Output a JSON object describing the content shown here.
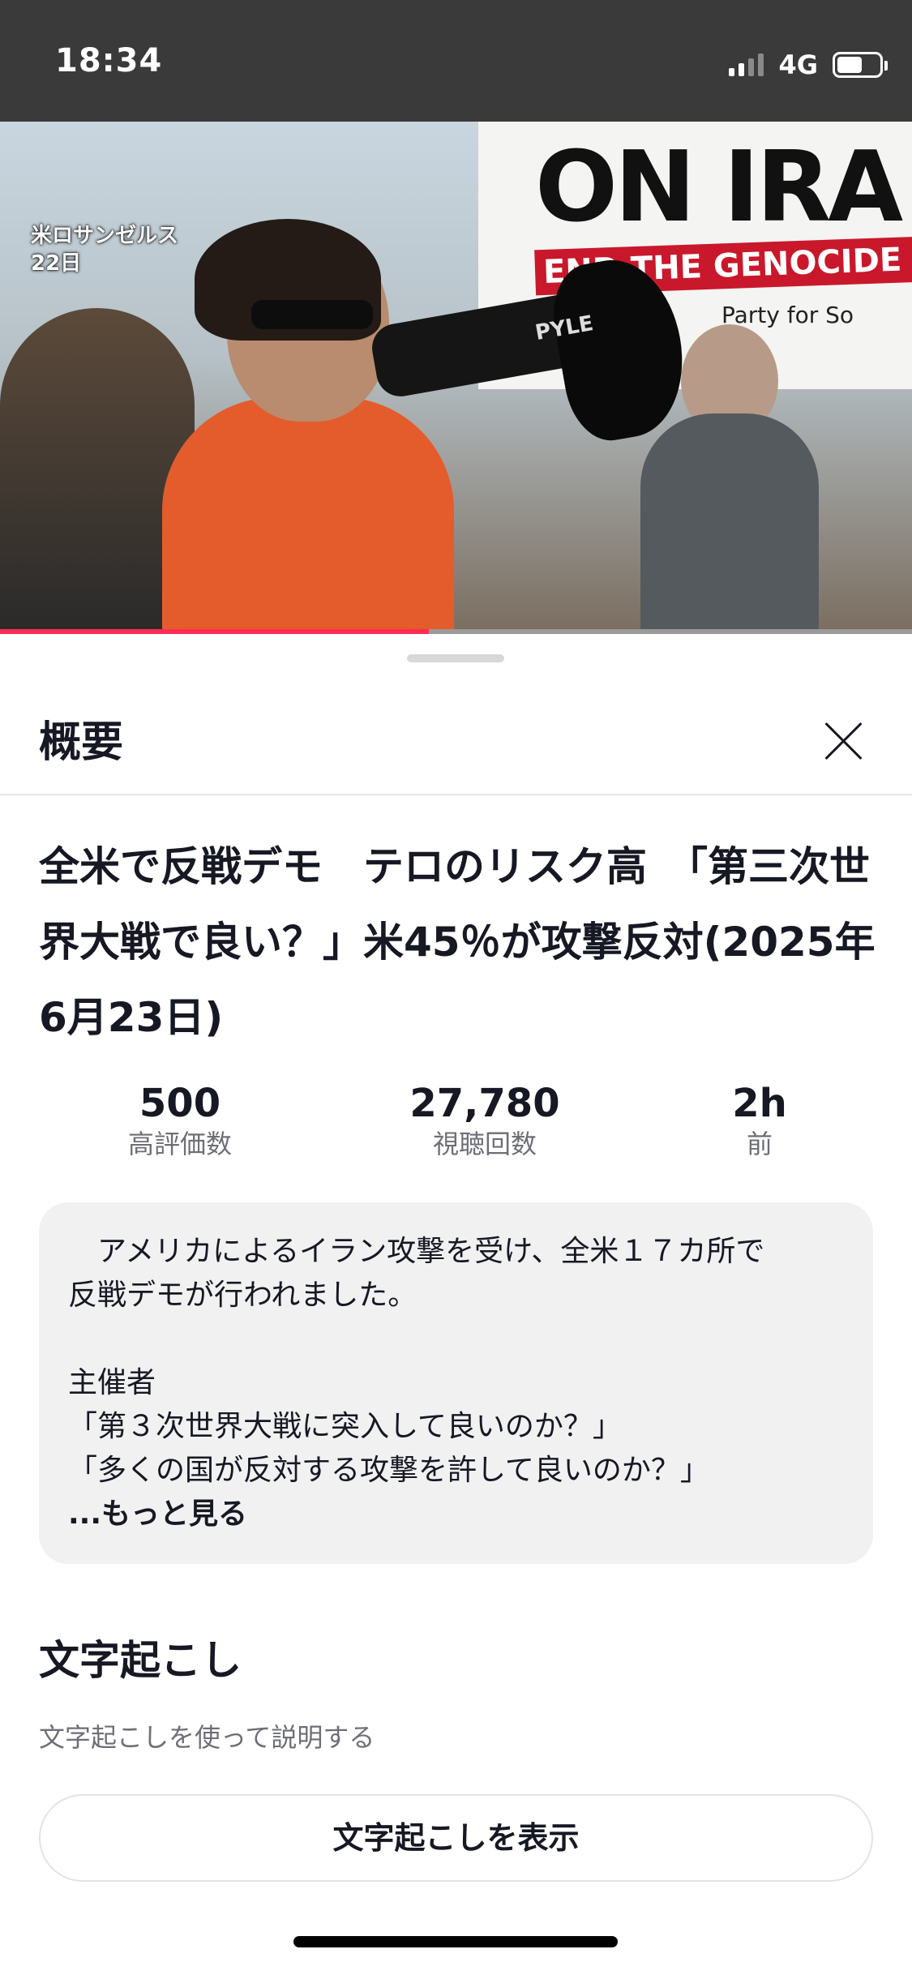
{
  "status_bar": {
    "time": "18:34",
    "network": "4G",
    "signal_bars": 2,
    "battery_level": 0.6
  },
  "video": {
    "caption_line1": "米ロサンゼルス",
    "caption_line2": "22日",
    "banner_text": "ON IRA",
    "banner_red_text": "END THE GENOCIDE",
    "banner_small_text": "Party for So",
    "megaphone_brand": "PYLE",
    "playback_progress": 0.47,
    "progress_color": "#fe2c55"
  },
  "sheet": {
    "title": "概要",
    "close_icon": "close-icon",
    "video_title": "全米で反戦デモ　テロのリスク高　「第三次世界大戦で良い？」米45％が攻撃反対(2025年6月23日)",
    "stats": [
      {
        "value": "500",
        "label": "高評価数"
      },
      {
        "value": "27,780",
        "label": "視聴回数"
      },
      {
        "value": "2h",
        "label": "前"
      }
    ],
    "description": {
      "line1": "　アメリカによるイラン攻撃を受け、全米１７カ所で",
      "line2": "反戦デモが行われました。",
      "line3": "主催者",
      "line4": "「第３次世界大戦に突入して良いのか？」",
      "line5": "「多くの国が反対する攻撃を許して良いのか？」",
      "more": "...もっと見る"
    },
    "transcript": {
      "title": "文字起こし",
      "subtitle": "文字起こしを使って説明する",
      "button_label": "文字起こしを表示"
    }
  }
}
